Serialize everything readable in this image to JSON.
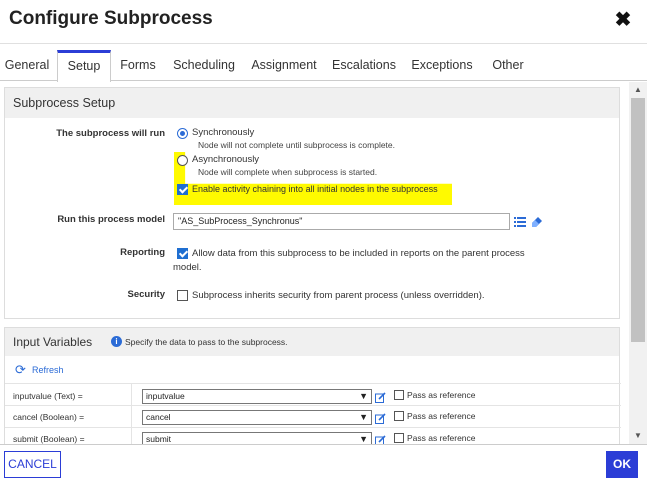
{
  "dialog": {
    "title": "Configure Subprocess",
    "close_glyph": "✖"
  },
  "tabs": [
    {
      "label": "General"
    },
    {
      "label": "Setup",
      "active": true
    },
    {
      "label": "Forms"
    },
    {
      "label": "Scheduling"
    },
    {
      "label": "Assignment"
    },
    {
      "label": "Escalations"
    },
    {
      "label": "Exceptions"
    },
    {
      "label": "Other"
    }
  ],
  "setup": {
    "heading": "Subprocess Setup",
    "run_label": "The subprocess will run",
    "sync_label": "Synchronously",
    "sync_desc": "Node will not complete until subprocess is complete.",
    "async_label": "Asynchronously",
    "async_desc": "Node will complete when subprocess is started.",
    "chaining_label": "Enable activity chaining into all initial nodes in the subprocess",
    "model_label": "Run this process model",
    "model_value": "\"AS_SubProcess_Synchronus\"",
    "reporting_label": "Reporting",
    "reporting_text_1": "Allow data from this subprocess to be included in reports on the parent process",
    "reporting_text_2": "model.",
    "security_label": "Security",
    "security_text": "Subprocess inherits security from parent process (unless overridden)."
  },
  "input_vars": {
    "heading": "Input Variables",
    "hint": "Specify the data to pass to the subprocess.",
    "refresh_label": "Refresh",
    "pass_ref_label": "Pass as reference",
    "rows": [
      {
        "name": "inputvalue (Text) =",
        "value": "inputvalue"
      },
      {
        "name": "cancel (Boolean) =",
        "value": "cancel"
      },
      {
        "name": "submit (Boolean) =",
        "value": "submit"
      }
    ]
  },
  "footer": {
    "cancel_label": "CANCEL",
    "ok_label": "OK"
  },
  "colors": {
    "accent": "#2b3dd6",
    "highlight": "#fffa00",
    "checkbox": "#1f6fd1"
  }
}
